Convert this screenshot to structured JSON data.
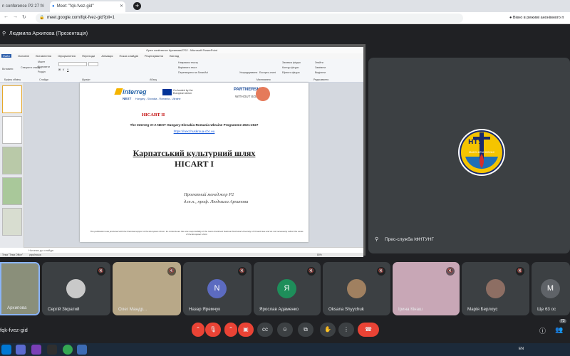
{
  "browser": {
    "tabs": [
      {
        "label": "n conference P2 27 fri",
        "active": false
      },
      {
        "label": "Meet: \"fqk-fvez-gid\"",
        "active": true
      },
      {
        "label": "",
        "active": false
      }
    ],
    "url": "meet.google.com/fqk-fvez-gid?pli=1",
    "incognito_label": "Вікно в режимі анонімного п"
  },
  "presenter": {
    "name": "Людмила Архипова (Презентація)"
  },
  "powerpoint": {
    "window_title": "Open conference Архипова2702 - Microsoft PowerPoint",
    "menu": [
      "Файл",
      "Основне",
      "Вставлення",
      "Оформлення",
      "Переходи",
      "Анімація",
      "Показ слайдів",
      "Рецензування",
      "Вигляд"
    ],
    "ribbon": {
      "paste_label": "Вставити",
      "create_slide": "Створити слайд",
      "layout": "Макет",
      "reset": "Відновити",
      "section": "Розділ",
      "arrange": "Упорядкування",
      "quick_styles": "Експрес-стилі",
      "find": "Знайти",
      "replace": "Замінити",
      "select": "Виділити",
      "editing": "Редагування",
      "drawing": "Малювання",
      "paragraph": "Абзац",
      "font_group": "Шрифт",
      "slides_group": "Слайди",
      "clipboard": "Буфер обміну",
      "text_direction": "Напрямок тексту",
      "align_text": "Вирівняти текст",
      "smartart": "Перетворити на SmartArt",
      "shape_fill": "Заливка фігури",
      "shape_outline": "Контур фігури",
      "shape_effects": "Ефекти фігури"
    },
    "notes_placeholder": "Нотатки до слайда",
    "status_left": "Тема \"Тема Office\"",
    "status_lang": "українська",
    "zoom": "80%"
  },
  "slide": {
    "interreg_brand": "interreg",
    "next_label": "NEXT",
    "countries": "Hungary - Slovakia - Romania - Ukraine",
    "cofunded": "Co-funded by the European Union",
    "partnership": "PARTNERSHIP",
    "without_borders": "WITHOUT BORDERS",
    "hicart2": "HICART II",
    "programme": "The Interreg VI-A NEXT Hungary-Slovakia-Romania-Ukraine Programme 2021-2027",
    "link": "https://next.huskroua-cbc.eu",
    "title_line1": "Карпатський культурний шлях",
    "title_line2": "HICART I",
    "manager_line1": "Проектний менеджер Р2",
    "manager_line2": "д.т.н., проф. Людмила Архипова",
    "disclaimer": "The publication was produced with the financial support of the European Union. Its contents are the sole responsibility of the Ivano-Frankivsk National Technical University of Oil and Gas and do not necessarily reflect the views of the European Union"
  },
  "side_tile": {
    "name": "Прес-служба ІФНТУНГ",
    "logo_text": "НТУ",
    "logo_city": "ІВАНО-ФРАНКІВСЬК"
  },
  "participants": [
    {
      "name": "Архипова",
      "type": "photo",
      "color": "#8a8f7a",
      "muted": false
    },
    {
      "name": "Сергій Зікратий",
      "type": "photo",
      "color": "#c9c9c9",
      "muted": true
    },
    {
      "name": "Олег Мандр...",
      "type": "photo",
      "color": "#b8a888",
      "muted": true
    },
    {
      "name": "Назар Яремчук",
      "type": "letter",
      "letter": "N",
      "color": "#5c6bc0",
      "muted": true
    },
    {
      "name": "Ярослав Адаменко",
      "type": "letter",
      "letter": "Я",
      "color": "#1e8e5a",
      "muted": true
    },
    {
      "name": "Oksana Shyychuk",
      "type": "photo",
      "color": "#a08060",
      "muted": true
    },
    {
      "name": "Ірина Кінаш",
      "type": "photo",
      "color": "#c8a7b6",
      "muted": true
    },
    {
      "name": "Марія Берлоус",
      "type": "photo",
      "color": "#8d6e63",
      "muted": true
    },
    {
      "name": "Ще 63 ос",
      "type": "more",
      "letter": "М",
      "color": "#5f6368",
      "muted": false
    }
  ],
  "bottom": {
    "meeting_code": "fqk-fvez-gid",
    "people_count": "73"
  },
  "taskbar": {
    "lang": "EN"
  }
}
